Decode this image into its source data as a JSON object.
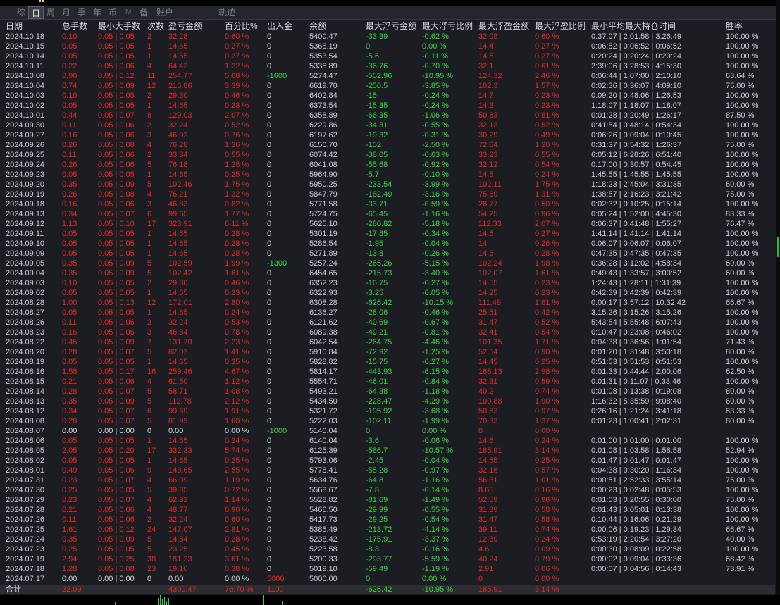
{
  "colors": {
    "profit": "#e8271e",
    "loss": "#34d73d",
    "text": "#c8ccd2"
  },
  "toolbar": {
    "tabs": [
      "综",
      "日",
      "周",
      "月",
      "季",
      "年",
      "币",
      "M",
      "备",
      "账户",
      "軌迹"
    ],
    "active_index": 1
  },
  "table": {
    "headers": [
      "日期",
      "总手数",
      "最小大手数",
      "次数",
      "盈亏金额",
      "百分比%",
      "出入金",
      "余额",
      "最大浮亏金额",
      "最大浮亏比例",
      "最大浮盈金额",
      "最大浮盈比例",
      "最小平均最大持仓时间",
      "胜率"
    ],
    "rows": [
      [
        "2024.10.18",
        "0.10",
        "0.05 | 0.05",
        "2",
        "32.28",
        "0.60 %",
        "0",
        "5400.47",
        "-33.39",
        "-0.62 %",
        "32.08",
        "0.60 %",
        "0:37:07 | 2:01:58 | 3:26:49",
        "100.00 %"
      ],
      [
        "2024.10.15",
        "0.05",
        "0.05 | 0.05",
        "1",
        "14.65",
        "0.27 %",
        "0",
        "5368.19",
        "0",
        "0.00 %",
        "14.4",
        "0.27 %",
        "0:06:52 | 0:06:52 | 0:06:52",
        "100.00 %"
      ],
      [
        "2024.10.14",
        "0.05",
        "0.05 | 0.05",
        "1",
        "14.65",
        "0.27 %",
        "0",
        "5353.54",
        "-5.6",
        "-0.11 %",
        "14.5",
        "0.27 %",
        "0:20:24 | 0:20:24 | 0:20:24",
        "100.00 %"
      ],
      [
        "2024.10.11",
        "0.22",
        "0.05 | 0.06",
        "4",
        "64.42",
        "1.22 %",
        "0",
        "5338.89",
        "-36.76",
        "-0.70 %",
        "32.1",
        "0.61 %",
        "2:39:06 | 3:28:53 | 4:15:30",
        "100.00 %"
      ],
      [
        "2024.10.08",
        "0.90",
        "0.05 | 0.12",
        "11",
        "254.77",
        "5.08 %",
        "-1600",
        "5274.47",
        "-552.96",
        "-10.95 %",
        "124.32",
        "2.46 %",
        "0:06:44 | 1:07:00 | 2:10:10",
        "63.64 %"
      ],
      [
        "2024.10.04",
        "0.74",
        "0.05 | 0.09",
        "12",
        "216.86",
        "3.39 %",
        "0",
        "6619.70",
        "-250.5",
        "-3.85 %",
        "102.3",
        "1.57 %",
        "0:02:36 | 0:36:07 | 4:09:10",
        "75.00 %"
      ],
      [
        "2024.10.03",
        "0.10",
        "0.05 | 0.05",
        "2",
        "29.30",
        "0.46 %",
        "0",
        "6402.84",
        "-15",
        "-0.24 %",
        "14.7",
        "0.23 %",
        "0:09:20 | 0:48:06 | 1:26:53",
        "100.00 %"
      ],
      [
        "2024.10.02",
        "0.05",
        "0.05 | 0.05",
        "1",
        "14.65",
        "0.23 %",
        "0",
        "6373.54",
        "-15.35",
        "-0.24 %",
        "14.3",
        "0.23 %",
        "1:18:07 | 1:18:07 | 1:18:07",
        "100.00 %"
      ],
      [
        "2024.10.01",
        "0.44",
        "0.05 | 0.07",
        "8",
        "129.03",
        "2.07 %",
        "0",
        "6358.89",
        "-66.35",
        "-1.06 %",
        "50.83",
        "0.81 %",
        "0:01:28 | 0:20:49 | 1:26:17",
        "87.50 %"
      ],
      [
        "2024.09.30",
        "0.11",
        "0.05 | 0.06",
        "2",
        "32.24",
        "0.52 %",
        "0",
        "6229.86",
        "-34.31",
        "-0.55 %",
        "32.13",
        "0.52 %",
        "0:41:54 | 0:48:14 | 0:54:34",
        "100.00 %"
      ],
      [
        "2024.09.27",
        "0.16",
        "0.05 | 0.06",
        "3",
        "46.92",
        "0.76 %",
        "0",
        "6197.62",
        "-19.32",
        "-0.31 %",
        "30.29",
        "0.49 %",
        "0:06:26 | 0:09:04 | 0:10:45",
        "100.00 %"
      ],
      [
        "2024.09.26",
        "0.26",
        "0.05 | 0.08",
        "4",
        "76.28",
        "1.26 %",
        "0",
        "6150.70",
        "-152",
        "-2.50 %",
        "72.64",
        "1.20 %",
        "0:31:37 | 0:54:32 | 1:26:37",
        "75.00 %"
      ],
      [
        "2024.09.25",
        "0.11",
        "0.05 | 0.06",
        "2",
        "33.34",
        "0.55 %",
        "0",
        "6074.42",
        "-38.05",
        "-0.63 %",
        "33.23",
        "0.55 %",
        "6:05:12 | 6:28:26 | 6:51:40",
        "100.00 %"
      ],
      [
        "2024.09.24",
        "0.26",
        "0.05 | 0.06",
        "5",
        "76.18",
        "1.28 %",
        "0",
        "6041.08",
        "-55.68",
        "-0.92 %",
        "32.12",
        "0.54 %",
        "0:17:00 | 0:30:57 | 0:54:45",
        "100.00 %"
      ],
      [
        "2024.09.23",
        "0.05",
        "0.05 | 0.05",
        "1",
        "14.65",
        "0.25 %",
        "0",
        "5964.90",
        "-5.7",
        "-0.10 %",
        "14.5",
        "0.24 %",
        "1:45:55 | 1:45:55 | 1:45:55",
        "100.00 %"
      ],
      [
        "2024.09.20",
        "0.35",
        "0.05 | 0.09",
        "5",
        "102.46",
        "1.75 %",
        "0",
        "5950.25",
        "-233.54",
        "-3.99 %",
        "102.11",
        "1.75 %",
        "1:18:23 | 2:45:04 | 3:31:35",
        "60.00 %"
      ],
      [
        "2024.09.19",
        "0.26",
        "0.05 | 0.08",
        "4",
        "76.21",
        "1.32 %",
        "0",
        "5847.79",
        "-182.49",
        "-3.16 %",
        "75.69",
        "1.31 %",
        "1:38:57 | 2:16:23 | 3:21:42",
        "75.00 %"
      ],
      [
        "2024.09.18",
        "0.16",
        "0.05 | 0.06",
        "3",
        "46.83",
        "0.82 %",
        "0",
        "5771.58",
        "-33.71",
        "-0.59 %",
        "28.77",
        "0.50 %",
        "0:02:32 | 0:10:25 | 0:15:14",
        "100.00 %"
      ],
      [
        "2024.09.13",
        "0.34",
        "0.05 | 0.07",
        "6",
        "99.65",
        "1.77 %",
        "0",
        "5724.75",
        "-65.45",
        "-1.16 %",
        "54.25",
        "0.96 %",
        "0:05:24 | 1:52:00 | 4:45:30",
        "83.33 %"
      ],
      [
        "2024.09.12",
        "1.13",
        "0.05 | 0.10",
        "17",
        "323.91",
        "6.11 %",
        "0",
        "5625.10",
        "-280.82",
        "-5.18 %",
        "112.33",
        "2.07 %",
        "0:06:37 | 0:41:48 | 1:55:27",
        "76.47 %"
      ],
      [
        "2024.09.11",
        "0.05",
        "0.05 | 0.05",
        "1",
        "14.65",
        "0.28 %",
        "0",
        "5301.19",
        "-17.85",
        "-0.34 %",
        "14.5",
        "0.27 %",
        "1:41:14 | 1:41:14 | 1:41:14",
        "100.00 %"
      ],
      [
        "2024.09.10",
        "0.05",
        "0.05 | 0.05",
        "1",
        "14.65",
        "0.28 %",
        "0",
        "5286.54",
        "-1.95",
        "-0.04 %",
        "14",
        "0.26 %",
        "0:06:07 | 0:06:07 | 0:06:07",
        "100.00 %"
      ],
      [
        "2024.09.09",
        "0.05",
        "0.05 | 0.05",
        "1",
        "14.65",
        "0.28 %",
        "0",
        "5271.89",
        "-13.8",
        "-0.26 %",
        "14.6",
        "0.28 %",
        "0:47:35 | 0:47:35 | 0:47:35",
        "100.00 %"
      ],
      [
        "2024.09.05",
        "0.35",
        "0.05 | 0.09",
        "5",
        "102.59",
        "1.99 %",
        "-1300",
        "5257.24",
        "-265.26",
        "-5.15 %",
        "102.24",
        "1.98 %",
        "0:36:28 | 3:12:02 | 4:58:34",
        "60.00 %"
      ],
      [
        "2024.09.04",
        "0.35",
        "0.05 | 0.09",
        "5",
        "102.42",
        "1.61 %",
        "0",
        "6454.65",
        "-215.73",
        "-3.40 %",
        "102.07",
        "1.61 %",
        "0:49:43 | 1:33:57 | 3:00:52",
        "60.00 %"
      ],
      [
        "2024.09.03",
        "0.10",
        "0.05 | 0.05",
        "2",
        "29.30",
        "0.46 %",
        "0",
        "6352.23",
        "-16.75",
        "-0.27 %",
        "14.55",
        "0.23 %",
        "1:24:43 | 1:28:11 | 1:31:39",
        "100.00 %"
      ],
      [
        "2024.09.02",
        "0.05",
        "0.05 | 0.05",
        "1",
        "14.65",
        "0.23 %",
        "0",
        "6322.93",
        "-3.25",
        "-0.05 %",
        "14.25",
        "0.23 %",
        "0:42:39 | 0:42:39 | 0:42:39",
        "100.00 %"
      ],
      [
        "2024.08.28",
        "1.00",
        "0.05 | 0.13",
        "12",
        "172.01",
        "2.80 %",
        "0",
        "6308.28",
        "-626.42",
        "-10.15 %",
        "111.49",
        "1.81 %",
        "0:00:17 | 3:57:12 | 10:32:42",
        "66.67 %"
      ],
      [
        "2024.08.27",
        "0.05",
        "0.05 | 0.05",
        "1",
        "14.65",
        "0.24 %",
        "0",
        "6136.27",
        "-28.06",
        "-0.46 %",
        "25.51",
        "0.42 %",
        "3:15:26 | 3:15:26 | 3:15:26",
        "100.00 %"
      ],
      [
        "2024.08.26",
        "0.11",
        "0.05 | 0.06",
        "2",
        "32.24",
        "0.53 %",
        "0",
        "6121.62",
        "-40.69",
        "-0.67 %",
        "31.47",
        "0.52 %",
        "5:43:54 | 5:55:48 | 6:07:43",
        "100.00 %"
      ],
      [
        "2024.08.23",
        "0.16",
        "0.05 | 0.06",
        "3",
        "46.84",
        "0.78 %",
        "0",
        "6089.38",
        "-49.21",
        "-0.81 %",
        "32.41",
        "0.54 %",
        "0:10:47 | 0:23:08 | 0:46:02",
        "100.00 %"
      ],
      [
        "2024.08.22",
        "0.45",
        "0.05 | 0.09",
        "7",
        "131.70",
        "2.23 %",
        "0",
        "6042.54",
        "-264.75",
        "-4.46 %",
        "101.35",
        "1.71 %",
        "0:04:38 | 0:36:56 | 1:01:54",
        "71.43 %"
      ],
      [
        "2024.08.20",
        "0.28",
        "0.05 | 0.07",
        "5",
        "82.02",
        "1.41 %",
        "0",
        "5910.84",
        "-72.92",
        "-1.25 %",
        "52.54",
        "0.90 %",
        "0:01:20 | 1:31:48 | 3:50:18",
        "80.00 %"
      ],
      [
        "2024.08.19",
        "0.05",
        "0.05 | 0.05",
        "1",
        "14.65",
        "0.25 %",
        "0",
        "5828.82",
        "-15.75",
        "-0.27 %",
        "14.45",
        "0.25 %",
        "0:51:53 | 0:51:53 | 0:51:53",
        "100.00 %"
      ],
      [
        "2024.08.16",
        "1.58",
        "0.05 | 0.17",
        "16",
        "259.46",
        "4.67 %",
        "0",
        "5814.17",
        "-443.93",
        "-6.15 %",
        "168.13",
        "2.98 %",
        "0:01:33 | 0:44:44 | 2:00:06",
        "62.50 %"
      ],
      [
        "2024.08.15",
        "0.21",
        "0.05 | 0.06",
        "4",
        "61.50",
        "1.12 %",
        "0",
        "5554.71",
        "-46.01",
        "-0.84 %",
        "32.31",
        "0.59 %",
        "0:01:31 | 0:11:07 | 0:33:46",
        "100.00 %"
      ],
      [
        "2024.08.14",
        "0.28",
        "0.05 | 0.07",
        "5",
        "58.71",
        "1.08 %",
        "0",
        "5493.21",
        "-64.38",
        "-1.18 %",
        "40.2",
        "0.74 %",
        "0:01:08 | 0:13:38 | 0:19:08",
        "80.00 %"
      ],
      [
        "2024.08.13",
        "0.35",
        "0.05 | 0.09",
        "5",
        "112.78",
        "2.12 %",
        "0",
        "5434.50",
        "-228.47",
        "-4.29 %",
        "100.88",
        "1.90 %",
        "1:16:32 | 5:35:59 | 9:08:40",
        "60.00 %"
      ],
      [
        "2024.08.12",
        "0.34",
        "0.05 | 0.07",
        "6",
        "99.69",
        "1.91 %",
        "0",
        "5321.72",
        "-195.92",
        "-3.68 %",
        "50.83",
        "0.97 %",
        "0:26:16 | 1:21:24 | 3:41:18",
        "83.33 %"
      ],
      [
        "2024.08.08",
        "0.28",
        "0.05 | 0.07",
        "5",
        "81.99",
        "1.60 %",
        "0",
        "5222.03",
        "-102.11",
        "-1.99 %",
        "70.33",
        "1.37 %",
        "0:01:23 | 1:00:41 | 2:02:31",
        "80.00 %"
      ],
      [
        "2024.08.07",
        "0.00",
        "0.00 | 0.00",
        "0",
        "0.00",
        "0.00 %",
        "-1000",
        "5140.04",
        "0",
        "0.00 %",
        "0",
        "0.00 %",
        "",
        ""
      ],
      [
        "2024.08.06",
        "0.05",
        "0.05 | 0.05",
        "1",
        "14.65",
        "0.24 %",
        "0",
        "6140.04",
        "-3.6",
        "-0.06 %",
        "14.6",
        "0.24 %",
        "0:01:00 | 0:01:00 | 0:01:00",
        "100.00 %"
      ],
      [
        "2024.08.05",
        "2.05",
        "0.05 | 0.20",
        "17",
        "332.33",
        "5.74 %",
        "0",
        "6125.39",
        "-586.7",
        "-10.57 %",
        "185.91",
        "3.14 %",
        "0:01:08 | 1:03:58 | 1:58:58",
        "52.94 %"
      ],
      [
        "2024.08.02",
        "0.05",
        "0.05 | 0.05",
        "1",
        "14.65",
        "0.25 %",
        "0",
        "5793.06",
        "-2.45",
        "-0.04 %",
        "14.55",
        "0.25 %",
        "0:01:47 | 0:01:47 | 0:01:47",
        "100.00 %"
      ],
      [
        "2024.08.01",
        "0.49",
        "0.05 | 0.06",
        "9",
        "143.65",
        "2.55 %",
        "0",
        "5778.41",
        "-55.28",
        "-0.97 %",
        "32.16",
        "0.57 %",
        "0:04:38 | 0:30:20 | 1:16:34",
        "100.00 %"
      ],
      [
        "2024.07.31",
        "0.23",
        "0.05 | 0.07",
        "4",
        "66.09",
        "1.19 %",
        "0",
        "5634.76",
        "-64.8",
        "-1.16 %",
        "56.31",
        "1.01 %",
        "0:00:51 | 2:52:33 | 3:55:14",
        "75.00 %"
      ],
      [
        "2024.07.30",
        "0.25",
        "0.05 | 0.05",
        "5",
        "39.85",
        "0.72 %",
        "0",
        "5568.67",
        "-7.8",
        "-0.14 %",
        "8.65",
        "0.16 %",
        "0:00:23 | 0:02:48 | 0:05:53",
        "100.00 %"
      ],
      [
        "2024.07.29",
        "0.23",
        "0.05 | 0.07",
        "4",
        "62.32",
        "1.14 %",
        "0",
        "5528.82",
        "-81.69",
        "-1.49 %",
        "52.59",
        "0.96 %",
        "0:01:03 | 0:20:55 | 0:30:00",
        "75.00 %"
      ],
      [
        "2024.07.28",
        "0.21",
        "0.05 | 0.06",
        "4",
        "48.77",
        "0.90 %",
        "0",
        "5466.50",
        "-29.99",
        "-0.55 %",
        "31.39",
        "0.58 %",
        "0:01:43 | 0:05:01 | 0:13:38",
        "100.00 %"
      ],
      [
        "2024.07.26",
        "0.11",
        "0.05 | 0.06",
        "2",
        "32.24",
        "0.60 %",
        "0",
        "5417.73",
        "-29.25",
        "-0.54 %",
        "31.47",
        "0.58 %",
        "0:10:44 | 0:16:06 | 0:21:29",
        "100.00 %"
      ],
      [
        "2024.07.25",
        "1.61",
        "0.05 | 0.12",
        "24",
        "147.07",
        "2.81 %",
        "0",
        "5385.49",
        "-213.72",
        "-4.14 %",
        "39.11",
        "0.74 %",
        "0:00:06 | 0:19:23 | 1:29:34",
        "66.67 %"
      ],
      [
        "2024.07.24",
        "0.35",
        "0.05 | 0.09",
        "5",
        "14.84",
        "0.28 %",
        "0",
        "5238.42",
        "-175.91",
        "-3.37 %",
        "12.39",
        "0.24 %",
        "0:53:19 | 2:20:54 | 3:27:20",
        "40.00 %"
      ],
      [
        "2024.07.23",
        "0.25",
        "0.05 | 0.05",
        "5",
        "23.25",
        "0.45 %",
        "0",
        "5223.58",
        "-8.3",
        "-0.16 %",
        "4.6",
        "0.09 %",
        "0:00:30 | 0:08:09 | 0:22:58",
        "100.00 %"
      ],
      [
        "2024.07.19",
        "2.94",
        "0.05 | 0.25",
        "38",
        "181.23",
        "3.61 %",
        "0",
        "5200.33",
        "-293.77",
        "-5.59 %",
        "40.24",
        "0.79 %",
        "0:00:02 | 0:09:04 | 0:33:36",
        "68.42 %"
      ],
      [
        "2024.07.18",
        "1.28",
        "0.05 | 0.08",
        "23",
        "19.10",
        "0.38 %",
        "0",
        "5019.10",
        "-59.49",
        "-1.19 %",
        "2.91",
        "0.06 %",
        "0:00:07 | 0:04:56 | 0:14:43",
        "73.91 %"
      ],
      [
        "2024.07.17",
        "0.00",
        "0.00 | 0.00",
        "0",
        "0.00",
        "0.00 %",
        "5000",
        "5000.00",
        "0",
        "0.00 %",
        "0",
        "0.00 %",
        "",
        ""
      ]
    ],
    "total": [
      "合计",
      "22.09",
      "",
      "",
      "4300.47",
      "76.70 %",
      "1100",
      "",
      "-626.42",
      "-10.95 %",
      "185.91",
      "3.14 %",
      "",
      ""
    ]
  }
}
